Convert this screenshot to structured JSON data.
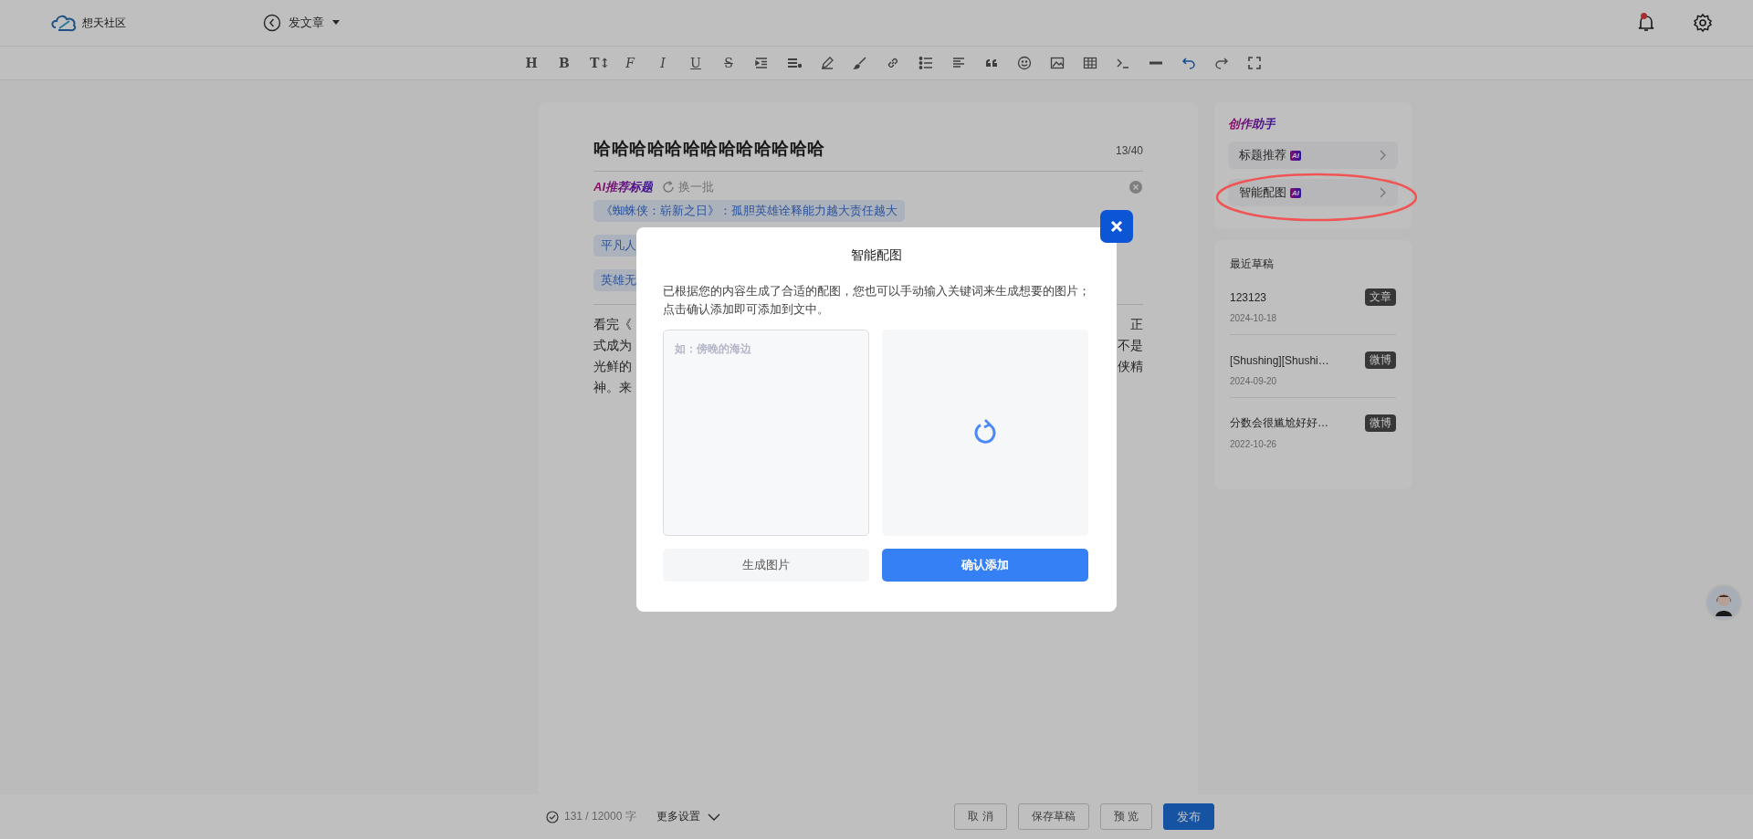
{
  "header": {
    "logo_text": "想天社区",
    "mode": "发文章",
    "notification_dot": true
  },
  "toolbar_glyphs": [
    "H",
    "B",
    "T↕",
    "F",
    "I",
    "U",
    "S"
  ],
  "editor": {
    "title": "哈哈哈哈哈哈哈哈哈哈哈哈哈",
    "count": "13/40",
    "ai": {
      "label": "AI推荐标题",
      "refresh": "换一批",
      "chips": [
        "《蜘蛛侠：崭新之日》：孤胆英雄诠释能力越大责任越大",
        "平凡人",
        "英雄无"
      ]
    },
    "body_lines": [
      {
        "left": "看完《",
        "right": "正"
      },
      {
        "left": "式成为",
        "right": "不是"
      },
      {
        "left": "光鲜的",
        "right": "侠精"
      },
      {
        "left": "神。来"
      }
    ]
  },
  "assistant": {
    "title": "创作助手",
    "items": [
      {
        "label": "标题推荐",
        "badge": "AI"
      },
      {
        "label": "智能配图",
        "badge": "AI"
      }
    ]
  },
  "drafts": {
    "title": "最近草稿",
    "items": [
      {
        "title": "123123",
        "date": "2024-10-18",
        "tag": "文章"
      },
      {
        "title": "[Shushing][Shushi…",
        "date": "2024-09-20",
        "tag": "微博"
      },
      {
        "title": "分数会很尴尬好好…",
        "date": "2022-10-26",
        "tag": "微博"
      }
    ]
  },
  "footer": {
    "word_count": "131 / 12000 字",
    "more": "更多设置",
    "buttons": [
      {
        "label": "取 消",
        "kind": "plain"
      },
      {
        "label": "保存草稿",
        "kind": "plain"
      },
      {
        "label": "预 览",
        "kind": "plain"
      },
      {
        "label": "发布",
        "kind": "primary"
      }
    ]
  },
  "modal": {
    "title": "智能配图",
    "description": "已根据您的内容生成了合适的配图，您也可以手动输入关键词来生成想要的图片；点击确认添加即可添加到文中。",
    "placeholder": "如：傍晚的海边",
    "loading": true,
    "buttons": [
      {
        "label": "生成图片",
        "kind": "plain"
      },
      {
        "label": "确认添加",
        "kind": "primary"
      }
    ]
  }
}
